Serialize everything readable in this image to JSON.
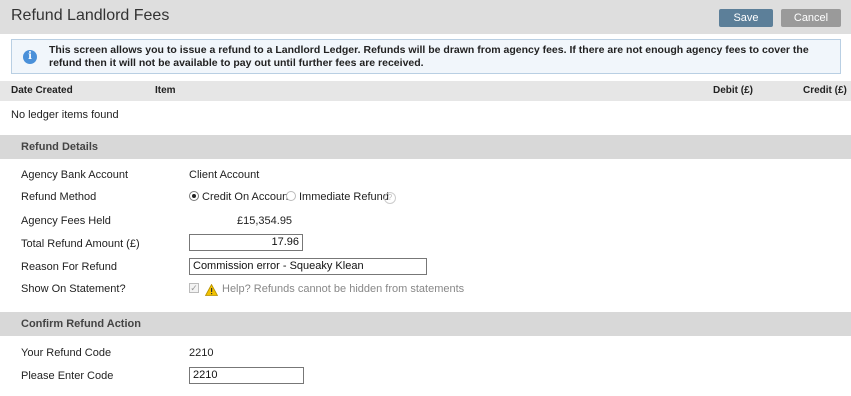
{
  "header": {
    "title": "Refund Landlord Fees",
    "save_label": "Save",
    "cancel_label": "Cancel"
  },
  "info": {
    "text": "This screen allows you to issue a refund to a Landlord Ledger.  Refunds will be drawn from agency fees.  If there are not enough agency fees to cover the refund then it will not be available to pay out until further fees are received."
  },
  "ledger": {
    "columns": [
      "Date Created",
      "Item",
      "Debit (£)",
      "Credit (£)"
    ],
    "empty_text": "No ledger items found"
  },
  "refund_details": {
    "heading": "Refund Details",
    "bank_account_label": "Agency Bank Account",
    "bank_account_value": "Client Account",
    "method_label": "Refund Method",
    "method_options": [
      "Credit On Account",
      "Immediate Refund"
    ],
    "method_selected": "Credit On Account",
    "fees_held_label": "Agency Fees Held",
    "fees_held_value": "£15,354.95",
    "total_label": "Total Refund Amount (£)",
    "total_value": "17.96",
    "reason_label": "Reason For Refund",
    "reason_value": "Commission error - Squeaky Klean",
    "statement_label": "Show On Statement?",
    "statement_checked": true,
    "statement_help": "Help? Refunds cannot be hidden from statements"
  },
  "confirm": {
    "heading": "Confirm Refund Action",
    "code_label": "Your Refund Code",
    "code_value": "2210",
    "enter_label": "Please Enter Code",
    "enter_value": "2210"
  },
  "colors": {
    "save": "#5c7f99",
    "cancel": "#9a9a9a",
    "info_icon": "#4a90d9",
    "warning": "#f2c200"
  }
}
